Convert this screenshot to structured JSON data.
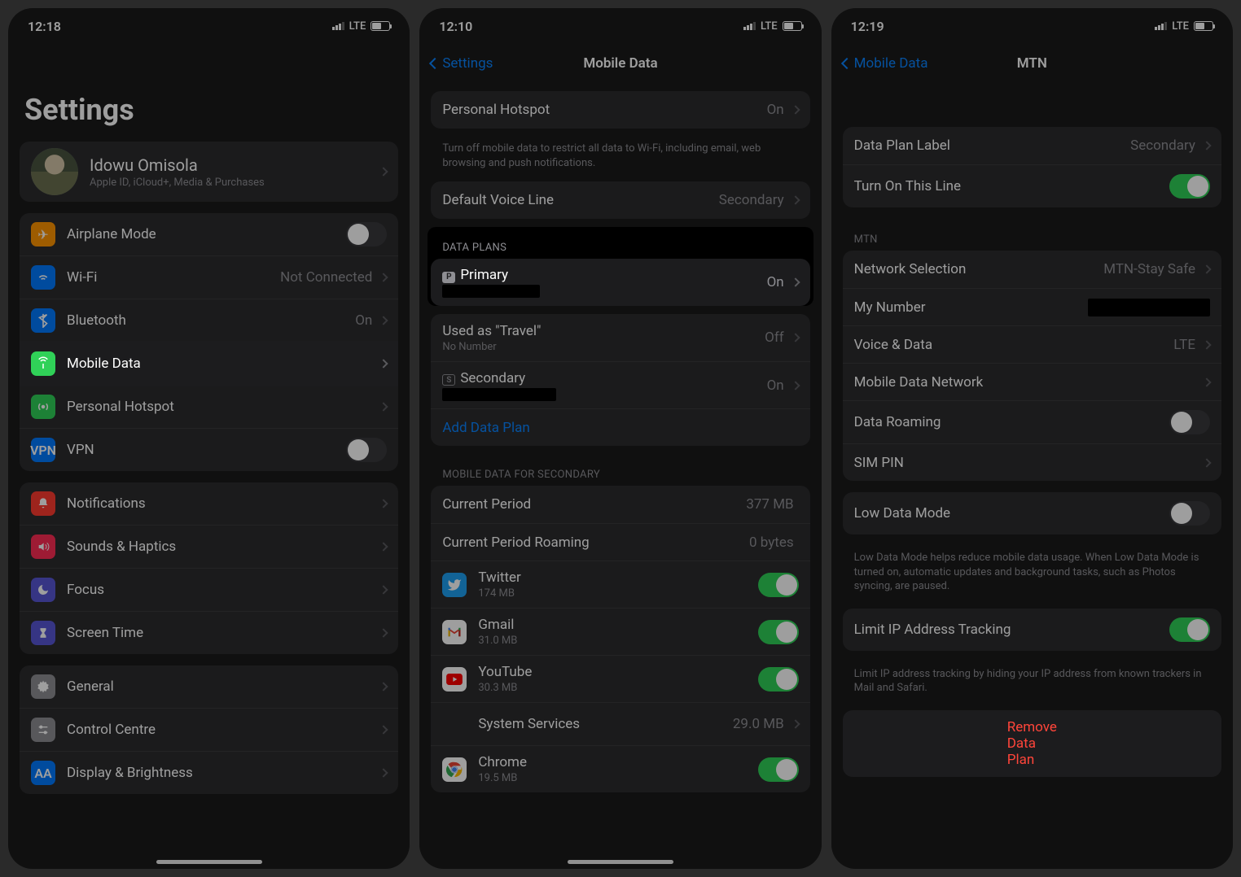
{
  "phone1": {
    "time": "12:18",
    "network": "LTE",
    "title": "Settings",
    "profile": {
      "name": "Idowu Omisola",
      "sub": "Apple ID, iCloud+, Media & Purchases"
    },
    "rows": {
      "airplane": "Airplane Mode",
      "wifi": "Wi-Fi",
      "wifi_val": "Not Connected",
      "bt": "Bluetooth",
      "bt_val": "On",
      "mobile": "Mobile Data",
      "hotspot": "Personal Hotspot",
      "vpn": "VPN",
      "notif": "Notifications",
      "sound": "Sounds & Haptics",
      "focus": "Focus",
      "screen": "Screen Time",
      "general": "General",
      "control": "Control Centre",
      "display": "Display & Brightness"
    }
  },
  "phone2": {
    "time": "12:10",
    "network": "LTE",
    "back": "Settings",
    "title": "Mobile Data",
    "hotspot": "Personal Hotspot",
    "hotspot_val": "On",
    "footer1": "Turn off mobile data to restrict all data to Wi-Fi, including email, web browsing and push notifications.",
    "voice": "Default Voice Line",
    "voice_val": "Secondary",
    "header_plans": "DATA PLANS",
    "plan_primary": "Primary",
    "plan_primary_val": "On",
    "plan_travel": "Used as \"Travel\"",
    "plan_travel_sub": "No Number",
    "plan_travel_val": "Off",
    "plan_secondary": "Secondary",
    "plan_secondary_val": "On",
    "add_plan": "Add Data Plan",
    "header_usage": "MOBILE DATA FOR SECONDARY",
    "current": "Current Period",
    "current_val": "377 MB",
    "roaming": "Current Period Roaming",
    "roaming_val": "0 bytes",
    "apps": {
      "twitter": "Twitter",
      "twitter_sub": "174 MB",
      "gmail": "Gmail",
      "gmail_sub": "31.0 MB",
      "youtube": "YouTube",
      "youtube_sub": "30.3 MB",
      "system": "System Services",
      "system_val": "29.0 MB",
      "chrome": "Chrome",
      "chrome_sub": "19.5 MB"
    }
  },
  "phone3": {
    "time": "12:19",
    "network": "LTE",
    "back": "Mobile Data",
    "title": "MTN",
    "label": "Data Plan Label",
    "label_val": "Secondary",
    "turn_on": "Turn On This Line",
    "header_mtn": "MTN",
    "netsel": "Network Selection",
    "netsel_val": "MTN-Stay Safe",
    "mynum": "My Number",
    "voicedata": "Voice & Data",
    "voicedata_val": "LTE",
    "mdn": "Mobile Data Network",
    "roam": "Data Roaming",
    "simpin": "SIM PIN",
    "lowdata": "Low Data Mode",
    "lowdata_footer": "Low Data Mode helps reduce mobile data usage. When Low Data Mode is turned on, automatic updates and background tasks, such as Photos syncing, are paused.",
    "limitip": "Limit IP Address Tracking",
    "limitip_footer": "Limit IP address tracking by hiding your IP address from known trackers in Mail and Safari.",
    "remove": "Remove Data Plan"
  }
}
